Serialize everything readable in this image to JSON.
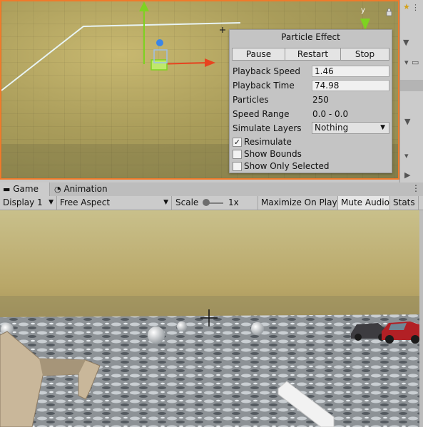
{
  "scene": {
    "gizmo_axis_label": "y"
  },
  "particle_effect": {
    "title": "Particle Effect",
    "buttons": {
      "pause": "Pause",
      "restart": "Restart",
      "stop": "Stop"
    },
    "playback_speed": {
      "label": "Playback Speed",
      "value": "1.46"
    },
    "playback_time": {
      "label": "Playback Time",
      "value": "74.98"
    },
    "particles": {
      "label": "Particles",
      "value": "250"
    },
    "speed_range": {
      "label": "Speed Range",
      "value": "0.0 - 0.0"
    },
    "simulate_layers": {
      "label": "Simulate Layers",
      "value": "Nothing"
    },
    "resimulate": {
      "label": "Resimulate",
      "checked": true,
      "mark": "✓"
    },
    "show_bounds": {
      "label": "Show Bounds",
      "checked": false
    },
    "show_only_selected": {
      "label": "Show Only Selected",
      "checked": false
    }
  },
  "tabs": [
    {
      "label": "Game",
      "icon": "gamepad-icon",
      "active": true
    },
    {
      "label": "Animation",
      "icon": "clock-icon",
      "active": false
    }
  ],
  "game_toolbar": {
    "display": "Display 1",
    "aspect": "Free Aspect",
    "scale_label": "Scale",
    "scale_value": "1x",
    "scale_position": 0.1,
    "maximize_on_play": "Maximize On Play",
    "mute_audio": "Mute Audio",
    "stats": "Stats"
  },
  "colors": {
    "scene_border": "#f07a2a",
    "gizmo_x": "#e8431f",
    "gizmo_y": "#7ed321",
    "gizmo_z": "#3a86e8"
  }
}
